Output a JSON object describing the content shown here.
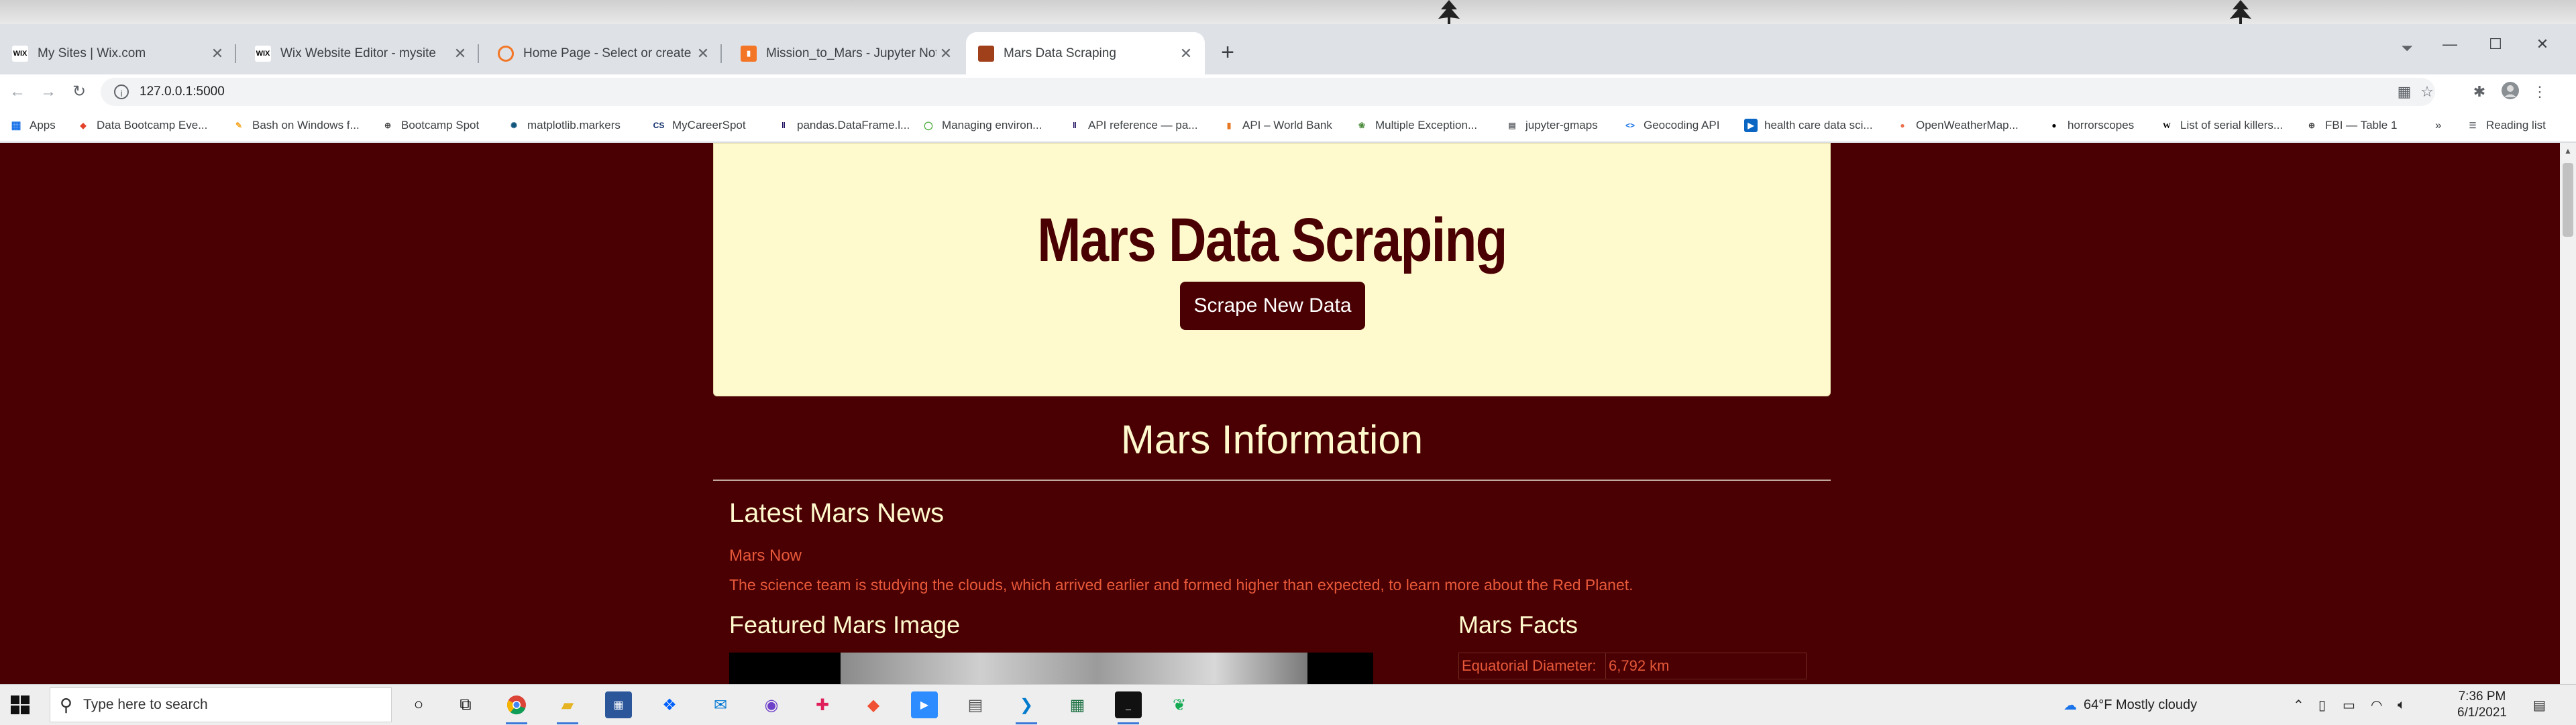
{
  "browser": {
    "tabs": [
      {
        "title": "My Sites | Wix.com",
        "icon": "wix-icon"
      },
      {
        "title": "Wix Website Editor - mysite",
        "icon": "wix-icon"
      },
      {
        "title": "Home Page - Select or create a n",
        "icon": "jupyter-icon"
      },
      {
        "title": "Mission_to_Mars - Jupyter Notebo",
        "icon": "jupyter-notebook-icon"
      },
      {
        "title": "Mars Data Scraping",
        "icon": "mars-icon"
      }
    ],
    "address": "127.0.0.1:5000",
    "bookmarks": [
      "Apps",
      "Data Bootcamp Eve...",
      "Bash on Windows f...",
      "Bootcamp Spot",
      "matplotlib.markers",
      "MyCareerSpot",
      "pandas.DataFrame.l...",
      "Managing environ...",
      "API reference — pa...",
      "API – World Bank",
      "Multiple Exception...",
      "jupyter-gmaps",
      "Geocoding API",
      "health care data sci...",
      "OpenWeatherMap...",
      "horrorscopes",
      "List of serial killers...",
      "FBI — Table 1"
    ],
    "reading_list": "Reading list",
    "more_bookmarks": "»"
  },
  "page": {
    "heading": "Mars Data Scraping",
    "scrape_button": "Scrape New Data",
    "section_title": "Mars Information",
    "news_heading": "Latest Mars News",
    "news_title": "Mars Now",
    "news_paragraph": "The science team is studying the clouds, which arrived earlier and formed higher than expected, to learn more about the Red Planet.",
    "image_heading": "Featured Mars Image",
    "facts_heading": "Mars Facts",
    "facts": [
      {
        "label": "Equatorial Diameter:",
        "value": "6,792 km"
      }
    ]
  },
  "taskbar": {
    "search_placeholder": "Type here to search",
    "weather": "64°F  Mostly cloudy",
    "time": "7:36 PM",
    "date": "6/1/2021"
  },
  "colors": {
    "page_bg": "#4a0002",
    "jumbotron_bg": "#fffacd",
    "accent_text": "#e8593a",
    "heading_text": "#fffacd"
  }
}
